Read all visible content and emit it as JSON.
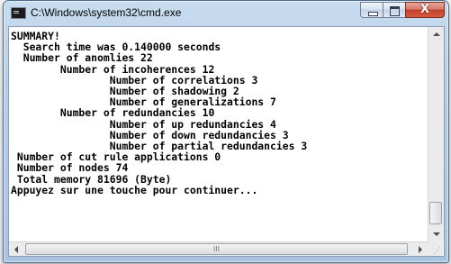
{
  "window": {
    "title": "C:\\Windows\\system32\\cmd.exe",
    "icon": "cmd-console-icon",
    "buttons": {
      "minimize_icon": "minimize-icon",
      "maximize_icon": "maximize-icon",
      "close_icon": "close-icon",
      "close_glyph": "X"
    }
  },
  "console": {
    "lines": [
      "SUMMARY!",
      "  Search time was 0.140000 seconds",
      "  Number of anomlies 22",
      "        Number of incoherences 12",
      "                Number of correlations 3",
      "                Number of shadowing 2",
      "                Number of generalizations 7",
      "        Number of redundancies 10",
      "                Number of up redundancies 4",
      "                Number of down redundancies 3",
      "                Number of partial redundancies 3",
      " Number of cut rule applications 0",
      " Number of nodes 74",
      " Total memory 81696 (Byte)",
      "Appuyez sur une touche pour continuer..."
    ]
  },
  "scrollbars": {
    "vertical": {
      "up_icon": "scroll-up-arrow-icon",
      "down_icon": "scroll-down-arrow-icon"
    },
    "horizontal": {
      "left_icon": "scroll-left-arrow-icon",
      "right_icon": "scroll-right-arrow-icon",
      "grip": "III"
    }
  }
}
